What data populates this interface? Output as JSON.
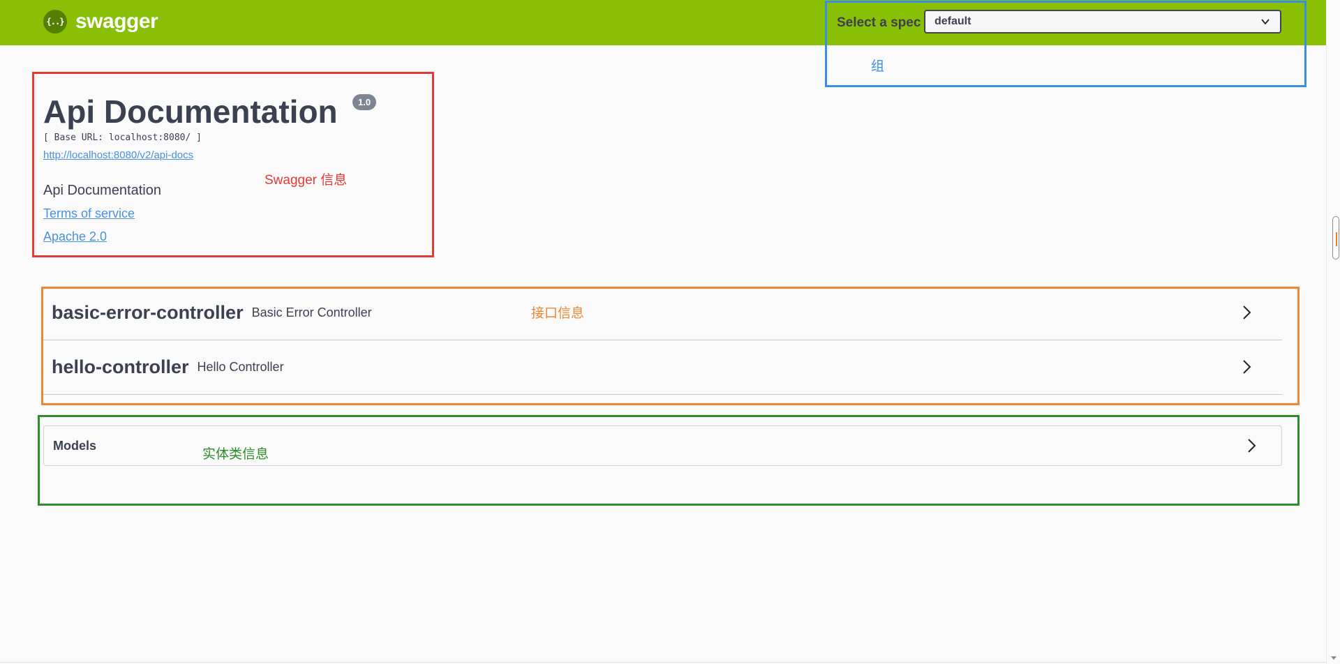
{
  "topbar": {
    "logo_text": "swagger",
    "logo_icon": "{..}",
    "spec_label": "Select a spec",
    "spec_selected": "default"
  },
  "info": {
    "title": "Api Documentation",
    "version": "1.0",
    "base_url": "[ Base URL: localhost:8080/ ]",
    "docs_url": "http://localhost:8080/v2/api-docs",
    "description": "Api Documentation",
    "terms_link": "Terms of service",
    "license_link": "Apache 2.0"
  },
  "controllers": [
    {
      "name": "basic-error-controller",
      "description": "Basic Error Controller"
    },
    {
      "name": "hello-controller",
      "description": "Hello Controller"
    }
  ],
  "models": {
    "title": "Models"
  },
  "annotations": {
    "group": {
      "label": "组",
      "color": "#3a8ee6"
    },
    "swagger_info": {
      "label": "Swagger 信息",
      "color": "#e53935"
    },
    "interface_info": {
      "label": "接口信息",
      "color": "#ef8633"
    },
    "entity_info": {
      "label": "实体类信息",
      "color": "#2e8b2e"
    }
  },
  "colors": {
    "topbar": "#89bf04",
    "link": "#4990e2",
    "text": "#3b4151",
    "badge": "#7d8492"
  }
}
